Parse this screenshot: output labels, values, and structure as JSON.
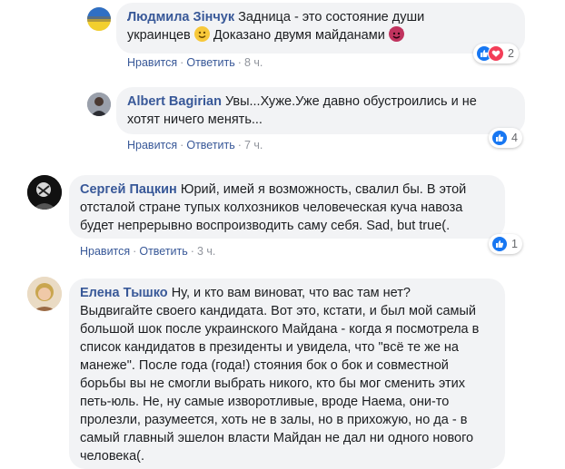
{
  "colors": {
    "link": "#385898",
    "meta": "#90949c",
    "bubble": "#f2f3f5",
    "like": "#1877f2",
    "love": "#f33e58"
  },
  "actions": {
    "like": "Нравится",
    "reply": "Ответить",
    "sep": "·"
  },
  "comments": [
    {
      "author": "Людмила Зінчук",
      "text_parts": [
        "Задница - это состояние души",
        "украинцев",
        "Доказано двумя майданами"
      ],
      "emojis": [
        "smiling-face-emoji",
        "smiling-devil-emoji"
      ],
      "time": "8 ч.",
      "reactions": {
        "icons": [
          "like-icon",
          "love-icon"
        ],
        "count": "2"
      }
    },
    {
      "author": "Albert Bagirian",
      "text_lines": [
        "Увы...Хуже.Уже давно обустроились и не",
        "хотят ничего менять..."
      ],
      "time": "7 ч.",
      "reactions": {
        "icons": [
          "like-icon"
        ],
        "count": "4"
      }
    },
    {
      "author": "Сергей Пацкин",
      "text_lines": [
        "Юрий, имей я возможность, свалил бы. В этой",
        "отсталой стране тупых колхозников человеческая куча навоза",
        "будет непрерывно воспроизводить саму себя. Sad, but true(."
      ],
      "time": "3 ч.",
      "reactions": {
        "icons": [
          "like-icon"
        ],
        "count": "1"
      }
    },
    {
      "author": "Елена Тышко",
      "text_lines": [
        "Ну, и кто вам виноват, что вас там нет?",
        "Выдвигайте своего кандидата. Вот это, кстати, и был мой самый",
        "большой шок после украинского Майдана - когда я посмотрела в",
        "список кандидатов в президенты и увидела, что \"всё те же на",
        "манеже\". После года (года!) стояния бок о бок и совместной",
        "борьбы вы не смогли выбрать никого, кто бы мог сменить этих",
        "петь-юль. Не, ну самые изворотливые, вроде Наема, они-то",
        "пролезли, разумеется, хоть не в залы, но в прихожую, но да - в",
        "самый главный эшелон власти Майдан не дал ни одного нового",
        "человека(."
      ]
    }
  ]
}
